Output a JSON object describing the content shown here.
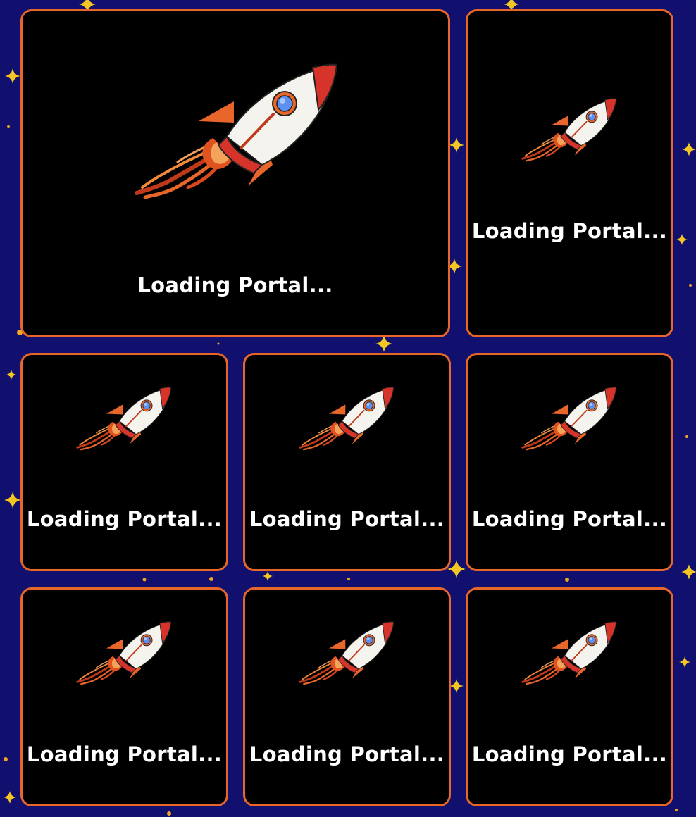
{
  "background_color": "#12106e",
  "tile_border_color": "#e8662a",
  "tiles": [
    {
      "id": "portal-1",
      "label": "Loading Portal...",
      "icon": "rocket-icon"
    },
    {
      "id": "portal-2",
      "label": "Loading Portal...",
      "icon": "rocket-icon"
    },
    {
      "id": "portal-3",
      "label": "Loading Portal...",
      "icon": "rocket-icon"
    },
    {
      "id": "portal-4",
      "label": "Loading Portal...",
      "icon": "rocket-icon"
    },
    {
      "id": "portal-5",
      "label": "Loading Portal...",
      "icon": "rocket-icon"
    },
    {
      "id": "portal-6",
      "label": "Loading Portal...",
      "icon": "rocket-icon"
    },
    {
      "id": "portal-7",
      "label": "Loading Portal...",
      "icon": "rocket-icon"
    },
    {
      "id": "portal-8",
      "label": "Loading Portal...",
      "icon": "rocket-icon"
    }
  ]
}
